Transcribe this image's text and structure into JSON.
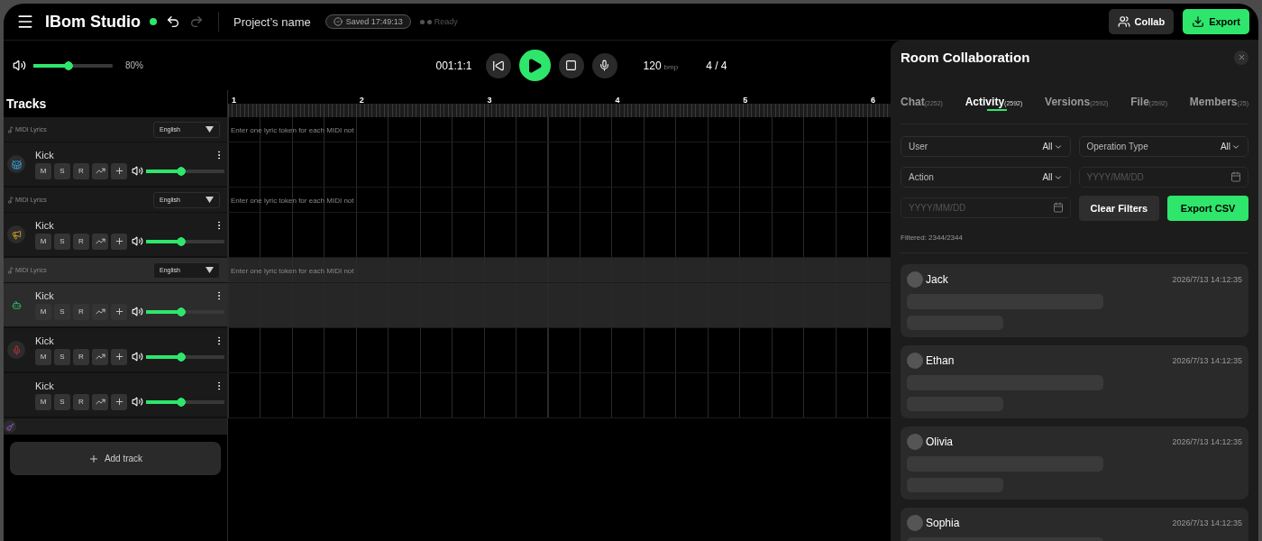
{
  "header": {
    "title": "IBom Studio",
    "online": true,
    "undo": {
      "disabled": false
    },
    "redo": {
      "disabled": true
    },
    "project_name": "Project’s name",
    "saved": "Saved 17:49:13",
    "status": "Ready",
    "buttons": [
      {
        "kind": "collab",
        "label": "Collab"
      },
      {
        "kind": "export",
        "label": "Export"
      }
    ]
  },
  "transport": {
    "volume": {
      "level": 0.5,
      "reading": "80%"
    },
    "time": "001:1:1",
    "playing": false,
    "tempo": "120",
    "tempo_unit": "bmp",
    "signature": "4 / 4"
  },
  "tracks_panel": {
    "title": "Tracks",
    "add_label": "Add track",
    "tracks": [
      {
        "lyrics": {
          "label": "MIDI Lyrics",
          "language": "English",
          "placeholder": "Enter one lyric token for each MIDI not"
        },
        "name": "Kick",
        "kind": "drum",
        "selected": false,
        "controls": [
          "M",
          "S",
          "R"
        ],
        "level": 0.5
      },
      {
        "lyrics": {
          "label": "MIDI Lyrics",
          "language": "English",
          "placeholder": "Enter one lyric token for each MIDI not"
        },
        "name": "Kick",
        "kind": "horn",
        "selected": false,
        "controls": [
          "M",
          "S",
          "R"
        ],
        "level": 0.5
      },
      {
        "lyrics": {
          "label": "MIDI Lyrics",
          "language": "English",
          "placeholder": "Enter one lyric token for each MIDI not"
        },
        "name": "Kick",
        "kind": "synth",
        "selected": true,
        "controls": [
          "M",
          "S",
          "R"
        ],
        "level": 0.5
      },
      {
        "name": "Kick",
        "kind": "mic",
        "selected": false,
        "controls": [
          "M",
          "S",
          "R"
        ],
        "level": 0.5
      },
      {
        "name": "Kick",
        "kind": "plain",
        "selected": false,
        "controls": [
          "M",
          "S",
          "R"
        ],
        "level": 0.5
      }
    ]
  },
  "ruler": [
    "1",
    "2",
    "3",
    "4",
    "5",
    "6"
  ],
  "collab_panel": {
    "title": "Room Collaboration",
    "tabs": [
      {
        "label": "Chat",
        "count": "(2252)",
        "selected": false
      },
      {
        "label": "Activity",
        "count": "(2592)",
        "selected": true
      },
      {
        "label": "Versions",
        "count": "(2592)",
        "selected": false
      },
      {
        "label": "File",
        "count": "(2592)",
        "selected": false
      },
      {
        "label": "Members",
        "count": "(25)",
        "selected": false
      }
    ],
    "filters": [
      {
        "kind": "select",
        "label": "User",
        "value": "All"
      },
      {
        "kind": "select",
        "label": "Operation Type",
        "value": "All"
      },
      {
        "kind": "select",
        "label": "Action",
        "value": "All"
      },
      {
        "kind": "date",
        "placeholder": "YYYY/MM/DD"
      },
      {
        "kind": "date",
        "placeholder": "YYYY/MM/DD"
      }
    ],
    "clear_label": "Clear Filters",
    "export_label": "Export CSV",
    "filtered": "Filtered: 2344/2344",
    "activities": [
      {
        "user": "Jack",
        "time": "2026/7/13 14:12:35",
        "loading": true
      },
      {
        "user": "Ethan",
        "time": "2026/7/13 14:12:35",
        "loading": true
      },
      {
        "user": "Olivia",
        "time": "2026/7/13 14:12:35",
        "loading": true
      },
      {
        "user": "Sophia",
        "time": "2026/7/13 14:12:35",
        "loading": true
      }
    ]
  }
}
